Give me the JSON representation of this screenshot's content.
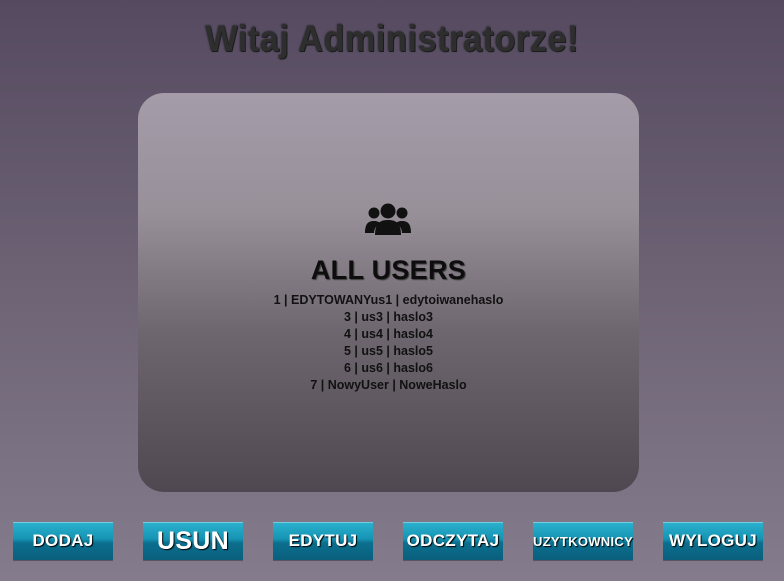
{
  "header": {
    "title": "Witaj Administratorze!"
  },
  "panel": {
    "icon": "users-icon",
    "heading": "ALL USERS",
    "users": [
      "1 | EDYTOWANYus1 | edytoiwanehaslo",
      "3 | us3 | haslo3",
      "4 | us4 | haslo4",
      "5 | us5 | haslo5",
      "6 | us6 | haslo6",
      "7 | NowyUser | NoweHaslo"
    ]
  },
  "nav": {
    "add": "DODAJ",
    "delete": "USUN",
    "edit": "EDYTUJ",
    "read": "ODCZYTAJ",
    "users": "UZYTKOWNICY",
    "logout": "WYLOGUJ"
  },
  "colors": {
    "accent": "#1693b3",
    "title": "#2e2e2e"
  }
}
